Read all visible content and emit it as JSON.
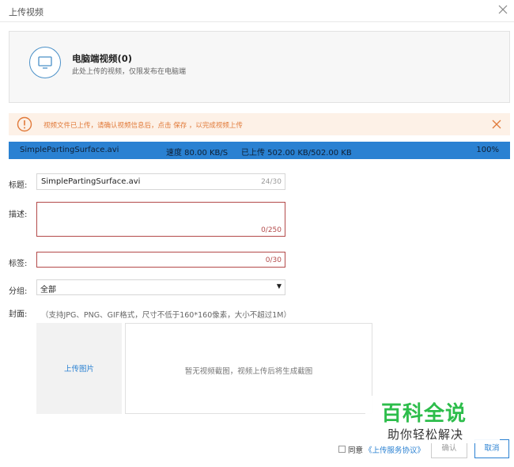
{
  "dialog": {
    "title": "上传视频"
  },
  "video_card": {
    "title": "电脑端视频(0)",
    "subtitle": "此处上传的视频，仅限发布在电脑端"
  },
  "notice": {
    "text": "视频文件已上传，请确认视频信息后，点击 保存 ，以完成视频上传"
  },
  "upload_progress": {
    "filename": "SimplePartingSurface.avi",
    "speed": "速度 80.00 KB/S",
    "uploaded": "已上传 502.00 KB/502.00 KB",
    "percent": "100%",
    "progress_fraction": 1.0
  },
  "form": {
    "title_label": "标题:",
    "title_value": "SimplePartingSurface.avi",
    "title_count": "24/30",
    "desc_label": "描述:",
    "desc_value": "",
    "desc_count": "0/250",
    "tags_label": "标签:",
    "tags_value": "",
    "tags_count": "0/30",
    "group_label": "分组:",
    "group_value": "全部",
    "group_arrow": "▼",
    "cover_label": "封面:",
    "cover_hint": "（支持JPG、PNG、GIF格式，尺寸不低于160*160像素，大小不超过1M）",
    "upload_image": "上传图片",
    "no_screenshot": "暂无视频截图，视频上传后将生成截图"
  },
  "footer": {
    "agree": "同意",
    "agreement_link": "《上传服务协议》",
    "confirm": "确认",
    "cancel": "取消"
  },
  "watermark": {
    "title": "百科全说",
    "subtitle": "助你轻松解决"
  },
  "colors": {
    "accent": "#2a81d2",
    "warning": "#e17a3a",
    "notice_bg": "#fdf1e7",
    "error": "#b34a4a",
    "watermark_green": "#2dbd4b"
  }
}
